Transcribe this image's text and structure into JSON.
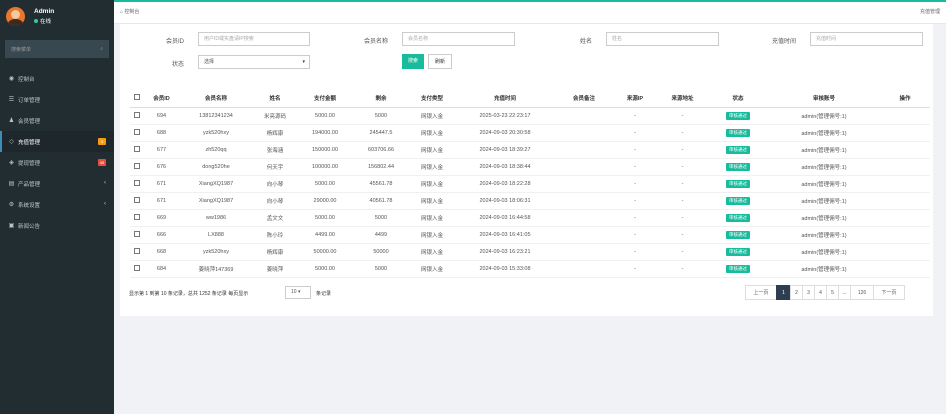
{
  "colors": {
    "accent": "#18bc9c",
    "primary": "#3c8dbc",
    "sidebar_bg": "#222d32",
    "badge_orange": "#f39c12",
    "badge_red": "#e74c3c",
    "active_page": "#2c3e50"
  },
  "sidebar": {
    "user": {
      "name": "Admin",
      "status": "在线"
    },
    "search": {
      "placeholder": "搜索菜单"
    },
    "items": [
      {
        "label": "控制台",
        "icon": "dashboard-icon"
      },
      {
        "label": "订单管理",
        "icon": "list-icon"
      },
      {
        "label": "会员管理",
        "icon": "users-icon"
      },
      {
        "label": "充值管理",
        "icon": "recharge-icon",
        "badge": "3",
        "active": true
      },
      {
        "label": "提现管理",
        "icon": "withdraw-icon",
        "badge": "45"
      },
      {
        "label": "产品管理",
        "icon": "product-icon",
        "has_children": true
      },
      {
        "label": "系统设置",
        "icon": "settings-icon",
        "has_children": true
      },
      {
        "label": "新闻公告",
        "icon": "news-icon"
      }
    ]
  },
  "topbar": {
    "breadcrumb": "控制台",
    "right": "充值管理"
  },
  "filters": {
    "member_id": {
      "label": "会员ID",
      "placeholder": "用户ID或实盘请IP搜索"
    },
    "member_name": {
      "label": "会员名称",
      "placeholder": "会员名称"
    },
    "name": {
      "label": "姓名",
      "placeholder": "姓名"
    },
    "recharge_time": {
      "label": "充值时间",
      "placeholder": "充值时间"
    },
    "status": {
      "label": "状态",
      "value": "选择"
    },
    "search_button": "搜索",
    "refresh_button": "刷新"
  },
  "table": {
    "headers": [
      "会员ID",
      "会员名称",
      "姓名",
      "支付金额",
      "剩余",
      "支付类型",
      "充值时间",
      "会员备注",
      "来源IP",
      "来源地址",
      "状态",
      "审核账号",
      "操作"
    ],
    "rows": [
      [
        "694",
        "13812341234",
        "米亮源码",
        "5000.00",
        "5000",
        "网银入金",
        "2025-03-23 22:23:17",
        "",
        "-",
        "-",
        "审核通过",
        "admin(管理佣号:1)",
        ""
      ],
      [
        "688",
        "yzk520hxy",
        "杨辉康",
        "194000.00",
        "245447.5",
        "网银入金",
        "2024-09-03 20:30:58",
        "",
        "-",
        "-",
        "审核通过",
        "admin(管理佣号:1)",
        ""
      ],
      [
        "677",
        "zh520qq",
        "张海涵",
        "150000.00",
        "603706.66",
        "网银入金",
        "2024-09-03 18:39:27",
        "",
        "-",
        "-",
        "审核通过",
        "admin(管理佣号:1)",
        ""
      ],
      [
        "676",
        "dong520he",
        "何天宇",
        "100000.00",
        "156802.44",
        "网银入金",
        "2024-09-03 18:38:44",
        "",
        "-",
        "-",
        "审核通过",
        "admin(管理佣号:1)",
        ""
      ],
      [
        "671",
        "XiangXQ1987",
        "向小琴",
        "5000.00",
        "45561.78",
        "网银入金",
        "2024-09-03 18:22:28",
        "",
        "-",
        "-",
        "审核通过",
        "admin(管理佣号:1)",
        ""
      ],
      [
        "671",
        "XiangXQ1987",
        "向小琴",
        "29000.00",
        "40561.78",
        "网银入金",
        "2024-09-03 18:06:31",
        "",
        "-",
        "-",
        "审核通过",
        "admin(管理佣号:1)",
        ""
      ],
      [
        "669",
        "ww1986",
        "孟文文",
        "5000.00",
        "5000",
        "网银入金",
        "2024-09-03 16:44:58",
        "",
        "-",
        "-",
        "审核通过",
        "admin(管理佣号:1)",
        ""
      ],
      [
        "666",
        "LX888",
        "陈小玲",
        "4499.00",
        "4499",
        "网银入金",
        "2024-09-03 16:41:05",
        "",
        "-",
        "-",
        "审核通过",
        "admin(管理佣号:1)",
        ""
      ],
      [
        "668",
        "yzk520hxy",
        "杨辉康",
        "50000.00",
        "50000",
        "网银入金",
        "2024-09-03 16:23:21",
        "",
        "-",
        "-",
        "审核通过",
        "admin(管理佣号:1)",
        ""
      ],
      [
        "684",
        "姜晓萍147369",
        "姜晓萍",
        "5000.00",
        "5000",
        "网银入金",
        "2024-09-03 15:33:08",
        "",
        "-",
        "-",
        "审核通过",
        "admin(管理佣号:1)",
        ""
      ]
    ]
  },
  "footer": {
    "summary": "显示第 1 到第 10 条记录，总共 1252 条记录 每页显示",
    "page_size": "10",
    "suffix": "条记录"
  },
  "pagination": [
    "上一页",
    "1",
    "2",
    "3",
    "4",
    "5",
    "...",
    "126",
    "下一页"
  ]
}
